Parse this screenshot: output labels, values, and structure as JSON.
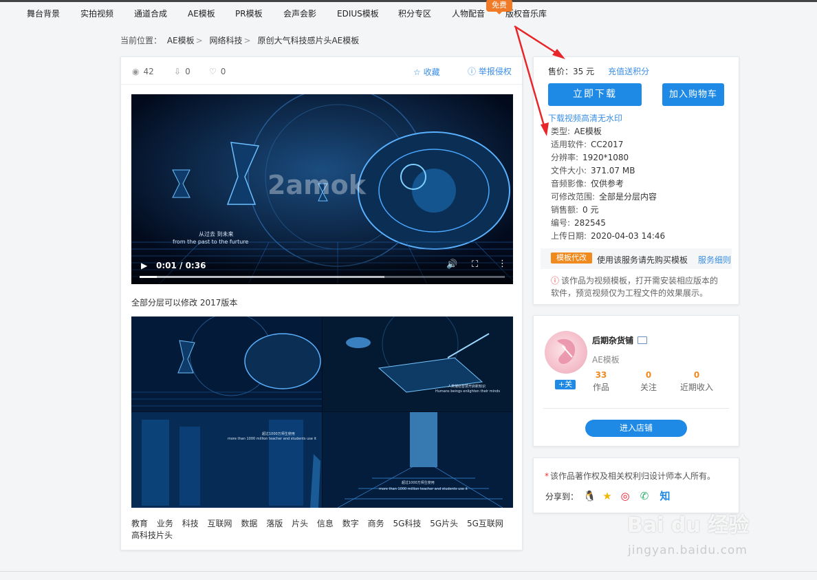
{
  "nav": {
    "items": [
      "舞台背景",
      "实拍视频",
      "通道合成",
      "AE模板",
      "PR模板",
      "会声会影",
      "EDIUS模板",
      "积分专区",
      "人物配音",
      "版权音乐库"
    ],
    "free_badge": "免费"
  },
  "breadcrumb": {
    "prefix": "当前位置：",
    "items": [
      "AE模板",
      "网络科技",
      "原创大气科技感片头AE模板"
    ]
  },
  "stats": {
    "views": "42",
    "downloads": "0",
    "likes": "0",
    "favorite_label": "收藏",
    "report_label": "举报侵权"
  },
  "video": {
    "time": "0:01 / 0:36",
    "progress": 0.047,
    "buffered": 0.67,
    "watermark": "2amok",
    "subtitle_cn": "从过去 到未来",
    "subtitle_en": "from the past to the furture"
  },
  "caption": "全部分层可以修改 2017版本",
  "preview": {
    "panel2_cn": "人类凝结智慧开启新知识",
    "panel2_en": "Humans beings enlighten their minds",
    "panel3_cn": "超过1000万师生使用",
    "panel3_en": "more than 1000 million teacher and students use it",
    "panel4_cn": "超过1000万师生使用",
    "panel4_en": "more than 1000 million teacher and students use it"
  },
  "tags": [
    "教育",
    "业务",
    "科技",
    "互联网",
    "数据",
    "落版",
    "片头",
    "信息",
    "数字",
    "商务",
    "5G科技",
    "5G片头",
    "5G互联网",
    "高科技片头"
  ],
  "purchase": {
    "price_label": "售价：",
    "price": "35 元",
    "recharge": "充值送积分",
    "download_btn": "立即下载",
    "cart_btn": "加入购物车",
    "hd_link": "下载视频高清无水印",
    "info": [
      {
        "k": "类型:",
        "v": "AE模板"
      },
      {
        "k": "适用软件:",
        "v": "CC2017"
      },
      {
        "k": "分辨率:",
        "v": "1920*1080"
      },
      {
        "k": "文件大小:",
        "v": "371.07 MB"
      },
      {
        "k": "音频影像:",
        "v": "仅供参考"
      },
      {
        "k": "可修改范围:",
        "v": "全部是分层内容"
      },
      {
        "k": "销售额:",
        "v": "0 元"
      },
      {
        "k": "编号:",
        "v": "282545"
      },
      {
        "k": "上传日期:",
        "v": "2020-04-03 14:46"
      }
    ],
    "service_badge": "模板代改",
    "service_text": "使用该服务请先购买模板",
    "service_detail": "服务细则",
    "notice": "该作品为视频模板，打开需安装相应版本的软件，预览视频仅为工程文件的效果展示。"
  },
  "author": {
    "name": "后期杂货铺",
    "type": "AE模板",
    "follow": "+关",
    "stats": [
      {
        "n": "33",
        "label": "作品"
      },
      {
        "n": "0",
        "label": "关注"
      },
      {
        "n": "0",
        "label": "近期收入"
      }
    ],
    "shop_btn": "进入店铺"
  },
  "copyright": {
    "text": "该作品著作权及相关权利归设计师本人所有。",
    "share_label": "分享到："
  },
  "watermark": {
    "brand": "Bai du 经验",
    "url": "jingyan.baidu.com"
  },
  "colors": {
    "accent": "#1e8ae6",
    "link": "#3a8ee6",
    "orange": "#f08a1e",
    "arrow": "#e8262a"
  }
}
